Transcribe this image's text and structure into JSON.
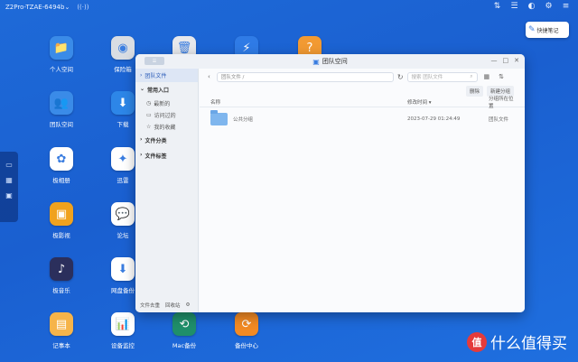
{
  "system": {
    "device_name": "Z2Pro-TZAE-6494b",
    "caret": "⌄",
    "wifi_glyph": "((·))",
    "tray_icons": [
      "upload-icon",
      "list-icon",
      "user-icon",
      "settings-icon",
      "menu-icon"
    ]
  },
  "desktop_icons": [
    {
      "label": "个人空间",
      "icon": "folder-icon",
      "color": "#3a8be8",
      "glyph": "📁"
    },
    {
      "label": "保险箱",
      "icon": "safe-icon",
      "color": "#d9dde3",
      "glyph": "◉"
    },
    {
      "label": "",
      "icon": "trash-icon",
      "color": "#e6e8ec",
      "glyph": "🗑"
    },
    {
      "label": "",
      "icon": "transfer-icon",
      "color": "#2f7be6",
      "glyph": "⚡"
    },
    {
      "label": "",
      "icon": "help-icon",
      "color": "#f29a32",
      "glyph": "?"
    },
    {
      "label": "团队空间",
      "icon": "team-folder-icon",
      "color": "#3a8be8",
      "glyph": "👥"
    },
    {
      "label": "下载",
      "icon": "download-icon",
      "color": "#2d86e8",
      "glyph": "⬇"
    },
    {
      "label": "极相册",
      "icon": "photos-icon",
      "color": "#ffffff",
      "glyph": "✿"
    },
    {
      "label": "迅雷",
      "icon": "xunlei-icon",
      "color": "#ffffff",
      "glyph": "✦"
    },
    {
      "label": "极影视",
      "icon": "video-icon",
      "color": "#f0a21e",
      "glyph": "▣"
    },
    {
      "label": "论坛",
      "icon": "forum-icon",
      "color": "#ffffff",
      "glyph": "💬"
    },
    {
      "label": "极音乐",
      "icon": "music-icon",
      "color": "#2b2f5c",
      "glyph": "♪"
    },
    {
      "label": "网盘备份",
      "icon": "cloud-backup-icon",
      "color": "#ffffff",
      "glyph": "⬇"
    },
    {
      "label": "记事本",
      "icon": "notes-icon",
      "color": "#f6b44a",
      "glyph": "▤"
    },
    {
      "label": "设备监控",
      "icon": "monitor-icon",
      "color": "#ffffff",
      "glyph": "📊"
    },
    {
      "label": "Mac备份",
      "icon": "mac-backup-icon",
      "color": "#1f8f6a",
      "glyph": "⟲"
    },
    {
      "label": "备份中心",
      "icon": "backup-center-icon",
      "color": "#f28a23",
      "glyph": "⟳"
    }
  ],
  "quick_note": {
    "label": "快捷笔记"
  },
  "window": {
    "title": "团队空间",
    "sidebar": {
      "team_files": "团队文件",
      "common_entry": "常用入口",
      "recent": "最新的",
      "visited": "访问过的",
      "favorites": "我的收藏",
      "file_category": "文件分类",
      "file_tags": "文件标签",
      "footer_notes": "文件去重",
      "footer_recycle": "回收站"
    },
    "path": "团队文件 /",
    "search_placeholder": "搜索 团队文件",
    "new_group_button": "新建分组",
    "delete_button": "删除",
    "columns": {
      "name": "名称",
      "date": "修改时间 ▾",
      "location": "分组所在位置"
    },
    "rows": [
      {
        "name": "公共分组",
        "date": "2023-07-29 01:24:49",
        "location": "团队文件"
      }
    ]
  },
  "watermark": {
    "text": "值 什么值得买"
  }
}
